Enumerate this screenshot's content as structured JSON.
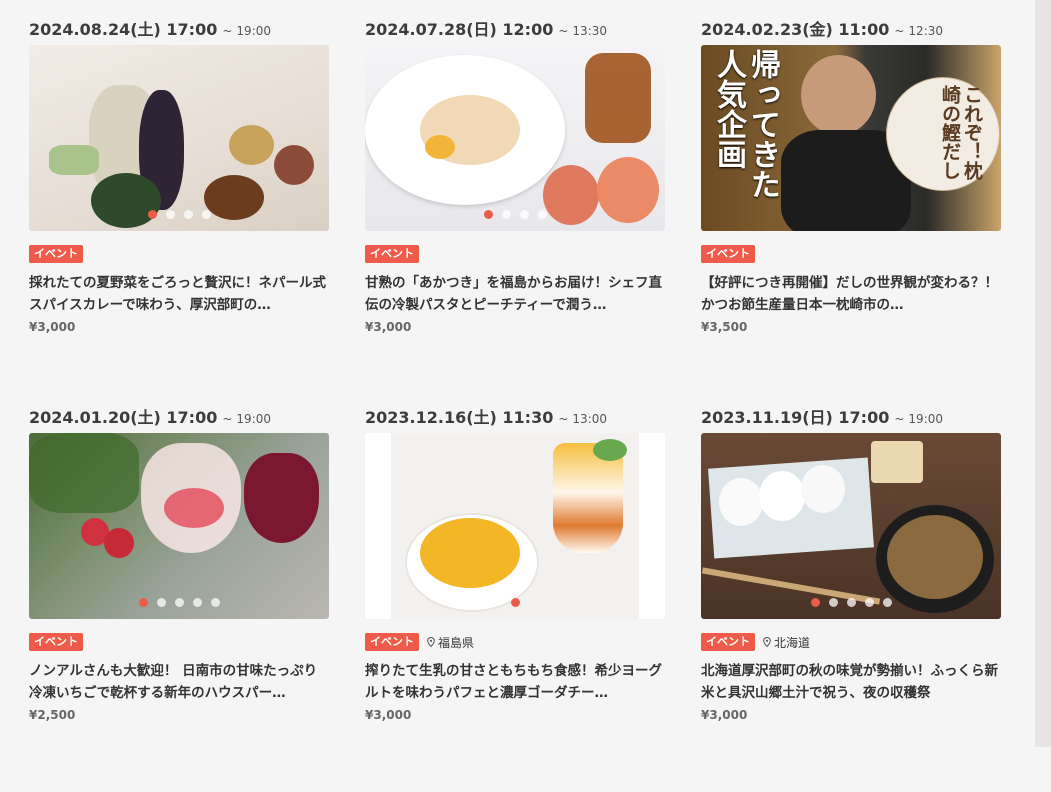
{
  "events": [
    {
      "date_start": "2024.08.24(土) 17:00",
      "date_end": "19:00",
      "badge": "イベント",
      "location": "",
      "title": "採れたての夏野菜をごろっと贅沢に！ネパール式スパイスカレーで味わう、厚沢部町の…",
      "price": "¥3,000",
      "dots": 4,
      "active_dot": 0
    },
    {
      "date_start": "2024.07.28(日) 12:00",
      "date_end": "13:30",
      "badge": "イベント",
      "location": "",
      "title": "甘熟の「あかつき」を福島からお届け！シェフ直伝の冷製パスタとピーチティーで潤う…",
      "price": "¥3,000",
      "dots": 4,
      "active_dot": 0
    },
    {
      "date_start": "2024.02.23(金) 11:00",
      "date_end": "12:30",
      "badge": "イベント",
      "location": "",
      "title": "【好評につき再開催】だしの世界観が変わる？！かつお節生産量日本一枕崎市の…",
      "price": "¥3,500",
      "dots": 0,
      "active_dot": 0,
      "overlay_left": "帰ってきた人気企画",
      "overlay_right": "これぞ！枕崎の鰹だし"
    },
    {
      "date_start": "2024.01.20(土) 17:00",
      "date_end": "19:00",
      "badge": "イベント",
      "location": "",
      "title": "ノンアルさんも大歓迎！ 日南市の甘味たっぷり冷凍いちごで乾杯する新年のハウスパー…",
      "price": "¥2,500",
      "dots": 5,
      "active_dot": 0
    },
    {
      "date_start": "2023.12.16(土) 11:30",
      "date_end": "13:00",
      "badge": "イベント",
      "location": "福島県",
      "title": "搾りたて生乳の甘さともちもち食感！希少ヨーグルトを味わうパフェと濃厚ゴーダチー…",
      "price": "¥3,000",
      "dots": 1,
      "active_dot": 0
    },
    {
      "date_start": "2023.11.19(日) 17:00",
      "date_end": "19:00",
      "badge": "イベント",
      "location": "北海道",
      "title": "北海道厚沢部町の秋の味覚が勢揃い！ふっくら新米と具沢山郷土汁で祝う、夜の収穫祭",
      "price": "¥3,000",
      "dots": 5,
      "active_dot": 0
    }
  ],
  "date_separator": "~",
  "colors": {
    "accent": "#ef5b4a",
    "background": "#f5f5f5"
  },
  "icons": {
    "location": "map-pin-icon"
  }
}
